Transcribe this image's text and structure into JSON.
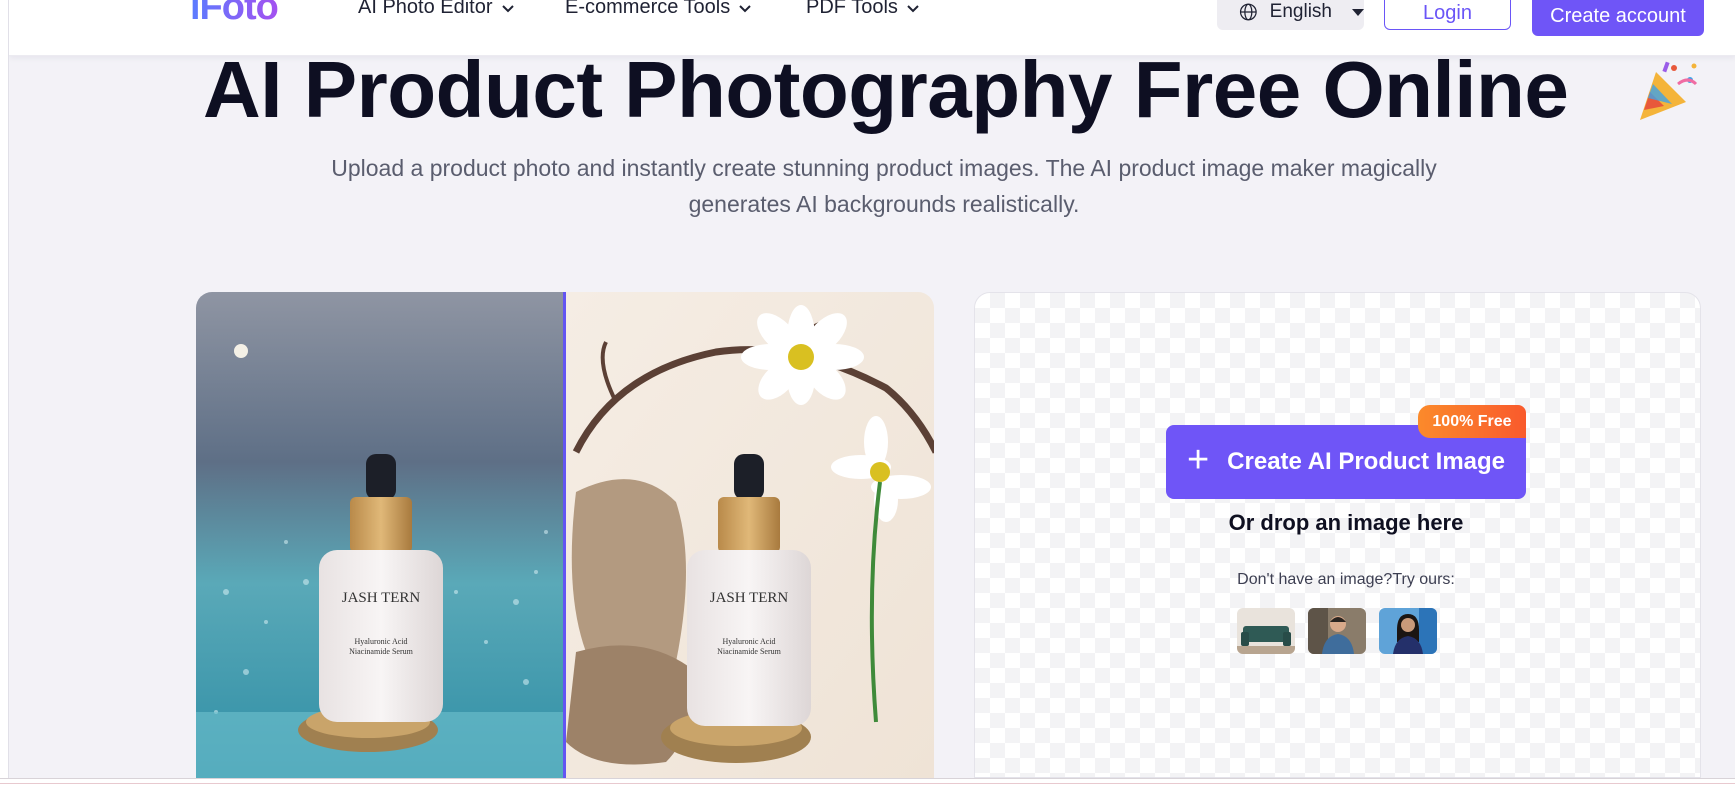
{
  "header": {
    "logo": "iFoto",
    "nav": [
      {
        "label": "AI Photo Editor"
      },
      {
        "label": "E-commerce Tools"
      },
      {
        "label": "PDF Tools"
      }
    ],
    "language": "English",
    "login_label": "Login",
    "create_account_label": "Create account"
  },
  "hero": {
    "title": "AI Product Photography Free Online",
    "subtitle": "Upload a product photo and instantly create stunning product images. The AI product image maker magically generates AI backgrounds realistically."
  },
  "compare": {
    "product_label_brand": "JASH TERN",
    "product_label_line1": "Hyaluronic Acid",
    "product_label_line2": "Niacinamide Serum"
  },
  "upload": {
    "cta_label": "Create AI Product Image",
    "badge": "100% Free",
    "drop_text": "Or drop an image here",
    "try_text": "Don't have an image?Try ours:",
    "samples": [
      "sofa-sample",
      "man-sample",
      "woman-sample"
    ]
  },
  "colors": {
    "accent": "#6f55f7",
    "badge_orange": "#f96f2c",
    "title": "#0e0f22"
  }
}
